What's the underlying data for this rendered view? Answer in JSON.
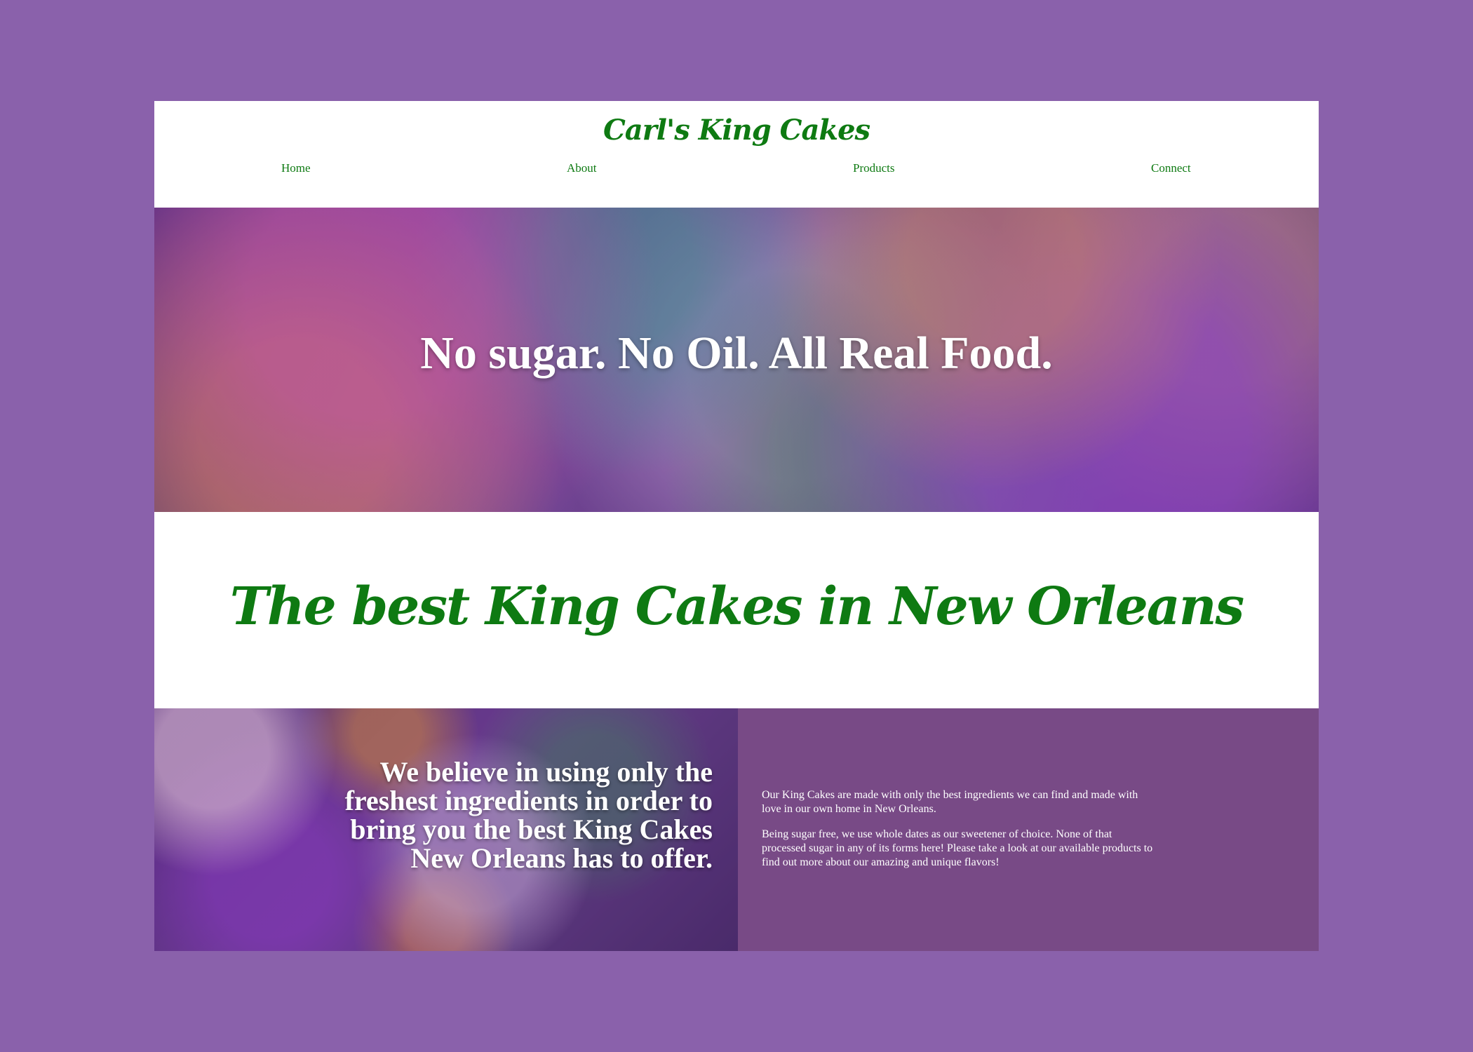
{
  "header": {
    "brand": "Carl's King Cakes",
    "nav": [
      "Home",
      "About",
      "Products",
      "Connect"
    ]
  },
  "hero": {
    "headline": "No sugar. No Oil. All Real Food."
  },
  "tagline": {
    "text": "The best King Cakes in New Orleans"
  },
  "about": {
    "statement": "We believe in using only the freshest ingredients in order to bring you the best King Cakes New Orleans has to offer.",
    "paragraph_1": "Our King Cakes are made with only the best ingredients we can find and made with love in our own home in New Orleans.",
    "paragraph_2": "Being sugar free, we use whole dates as our sweetener of choice. None of that processed sugar in any of its forms here! Please take a look at our available products to find out more about our amazing and unique flavors!"
  },
  "colors": {
    "page_background": "#8a61ab",
    "brand_green": "#0e7a12",
    "panel_purple": "#784a86",
    "text_white": "#ffffff"
  }
}
